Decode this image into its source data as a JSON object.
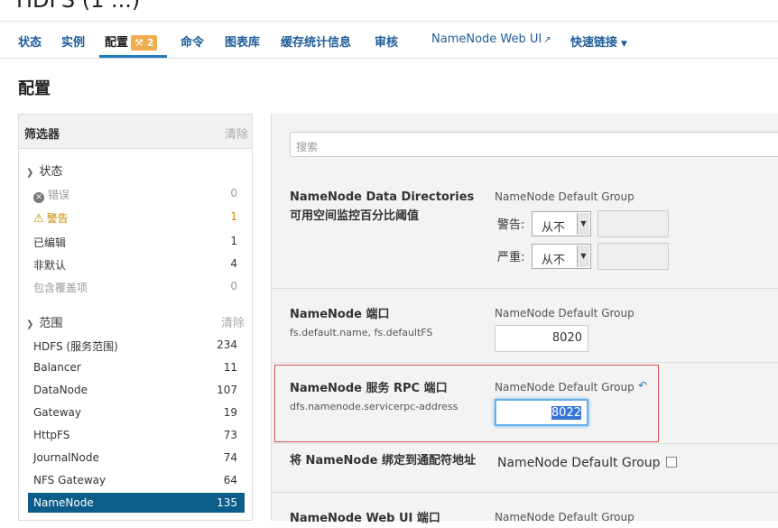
{
  "header": {
    "title": "HDFS (1 ...)"
  },
  "nav": {
    "tabs": [
      {
        "label": "状态"
      },
      {
        "label": "实例"
      },
      {
        "label": "配置",
        "badge": "2"
      },
      {
        "label": "命令"
      },
      {
        "label": "图表库"
      },
      {
        "label": "缓存统计信息"
      },
      {
        "label": "审核"
      },
      {
        "label": "NameNode Web UI"
      },
      {
        "label": "快速链接"
      }
    ]
  },
  "page": {
    "title": "配置"
  },
  "sidebar": {
    "title": "筛选器",
    "clear": "清除",
    "status": {
      "heading": "状态",
      "items": [
        {
          "label": "错误",
          "count": "0"
        },
        {
          "label": "警告",
          "count": "1"
        },
        {
          "label": "已编辑",
          "count": "1"
        },
        {
          "label": "非默认",
          "count": "4"
        },
        {
          "label": "包含覆盖项",
          "count": "0"
        }
      ]
    },
    "scope": {
      "heading": "范围",
      "clear": "清除",
      "items": [
        {
          "label": "HDFS (服务范围)",
          "count": "234"
        },
        {
          "label": "Balancer",
          "count": "11"
        },
        {
          "label": "DataNode",
          "count": "107"
        },
        {
          "label": "Gateway",
          "count": "19"
        },
        {
          "label": "HttpFS",
          "count": "73"
        },
        {
          "label": "JournalNode",
          "count": "74"
        },
        {
          "label": "NFS Gateway",
          "count": "64"
        },
        {
          "label": "NameNode",
          "count": "135"
        }
      ]
    }
  },
  "main": {
    "search_placeholder": "搜索",
    "configs": [
      {
        "name": "NameNode Data Directories 可用空间监控百分比阈值",
        "group": "NameNode Default Group",
        "warning_label": "警告:",
        "warning_value": "从不",
        "critical_label": "严重:",
        "critical_value": "从不"
      },
      {
        "name": "NameNode 端口",
        "key": "fs.default.name, fs.defaultFS",
        "group": "NameNode Default Group",
        "value": "8020"
      },
      {
        "name": "NameNode 服务 RPC 端口",
        "key": "dfs.namenode.servicerpc-address",
        "group": "NameNode Default Group",
        "value": "8022"
      },
      {
        "name": "将 NameNode 绑定到通配符地址",
        "group": "NameNode Default Group"
      },
      {
        "name": "NameNode Web UI 端口",
        "group": "NameNode Default Group"
      }
    ]
  }
}
